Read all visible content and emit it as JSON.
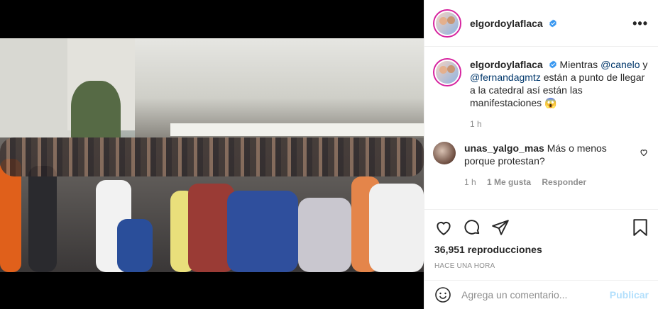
{
  "post": {
    "username": "elgordoylaflaca",
    "caption_text": "Mientras @canelo y @fernandagmtz están a punto de llegar a la catedral así están las manifestaciones 😱",
    "caption_parts": {
      "before1": "Mientras ",
      "mention1": "@canelo",
      "middle": " y ",
      "mention2": "@fernandagmtz",
      "after": " están a punto de llegar a la catedral así están las manifestaciones 😱"
    },
    "caption_time": "1 h",
    "views": "36,951 reproducciones",
    "posted_ago": "HACE UNA HORA"
  },
  "header": {
    "more_label": "•••"
  },
  "comment": {
    "username": "unas_yalgo_mas",
    "text": "Más o menos porque protestan?",
    "time": "1 h",
    "likes": "1 Me gusta",
    "reply_label": "Responder"
  },
  "add_comment": {
    "placeholder": "Agrega un comentario...",
    "publish_label": "Publicar"
  },
  "icons": {
    "like": "heart-icon",
    "comment": "comment-icon",
    "share": "paper-plane-icon",
    "save": "bookmark-icon",
    "emoji": "emoji-icon",
    "sound": "speaker-icon",
    "verified": "verified-badge-icon"
  },
  "colors": {
    "verified": "#3897f0",
    "mention": "#00376b",
    "publish_disabled": "#b2dffc"
  }
}
